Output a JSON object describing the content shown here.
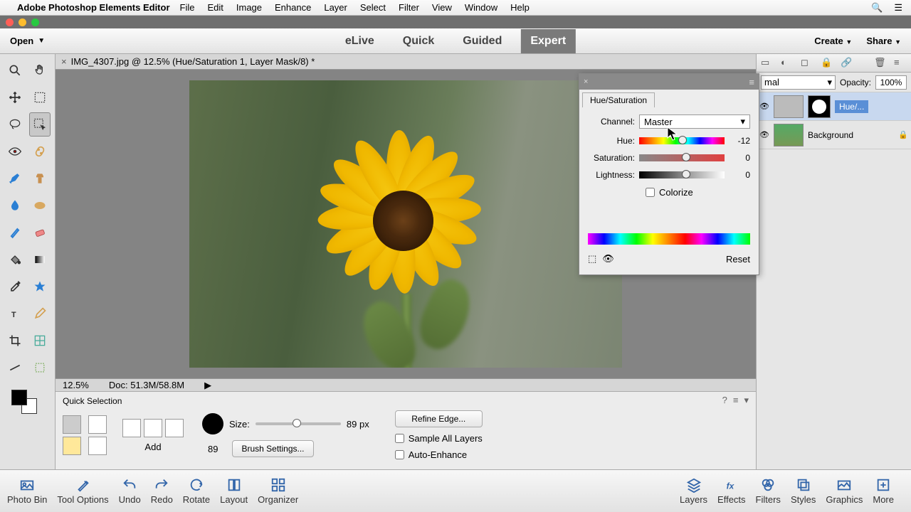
{
  "menubar": {
    "app": "Adobe Photoshop Elements Editor",
    "items": [
      "File",
      "Edit",
      "Image",
      "Enhance",
      "Layer",
      "Select",
      "Filter",
      "View",
      "Window",
      "Help"
    ]
  },
  "topbar": {
    "open": "Open",
    "modes": [
      "eLive",
      "Quick",
      "Guided",
      "Expert"
    ],
    "active_mode": "Expert",
    "create": "Create",
    "share": "Share"
  },
  "tab": {
    "title": "IMG_4307.jpg @ 12.5% (Hue/Saturation 1, Layer Mask/8) *"
  },
  "status": {
    "zoom": "12.5%",
    "doc": "Doc: 51.3M/58.8M"
  },
  "options": {
    "title": "Quick Selection",
    "add": "Add",
    "size_label": "Size:",
    "size_val": "89 px",
    "size_num": "89",
    "brush_settings": "Brush Settings...",
    "refine": "Refine Edge...",
    "sample": "Sample All Layers",
    "auto": "Auto-Enhance"
  },
  "layerspanel": {
    "blend": "mal",
    "opacity_label": "Opacity:",
    "opacity": "100%",
    "layers": [
      {
        "name": "Hue/..."
      },
      {
        "name": "Background"
      }
    ]
  },
  "hue": {
    "title": "Hue/Saturation",
    "channel_label": "Channel:",
    "channel": "Master",
    "hue_label": "Hue:",
    "hue_val": "-12",
    "sat_label": "Saturation:",
    "sat_val": "0",
    "lig_label": "Lightness:",
    "lig_val": "0",
    "colorize": "Colorize",
    "reset": "Reset"
  },
  "bottom": {
    "l": [
      "Photo Bin",
      "Tool Options",
      "Undo",
      "Redo",
      "Rotate",
      "Layout",
      "Organizer"
    ],
    "r": [
      "Layers",
      "Effects",
      "Filters",
      "Styles",
      "Graphics",
      "More"
    ]
  }
}
